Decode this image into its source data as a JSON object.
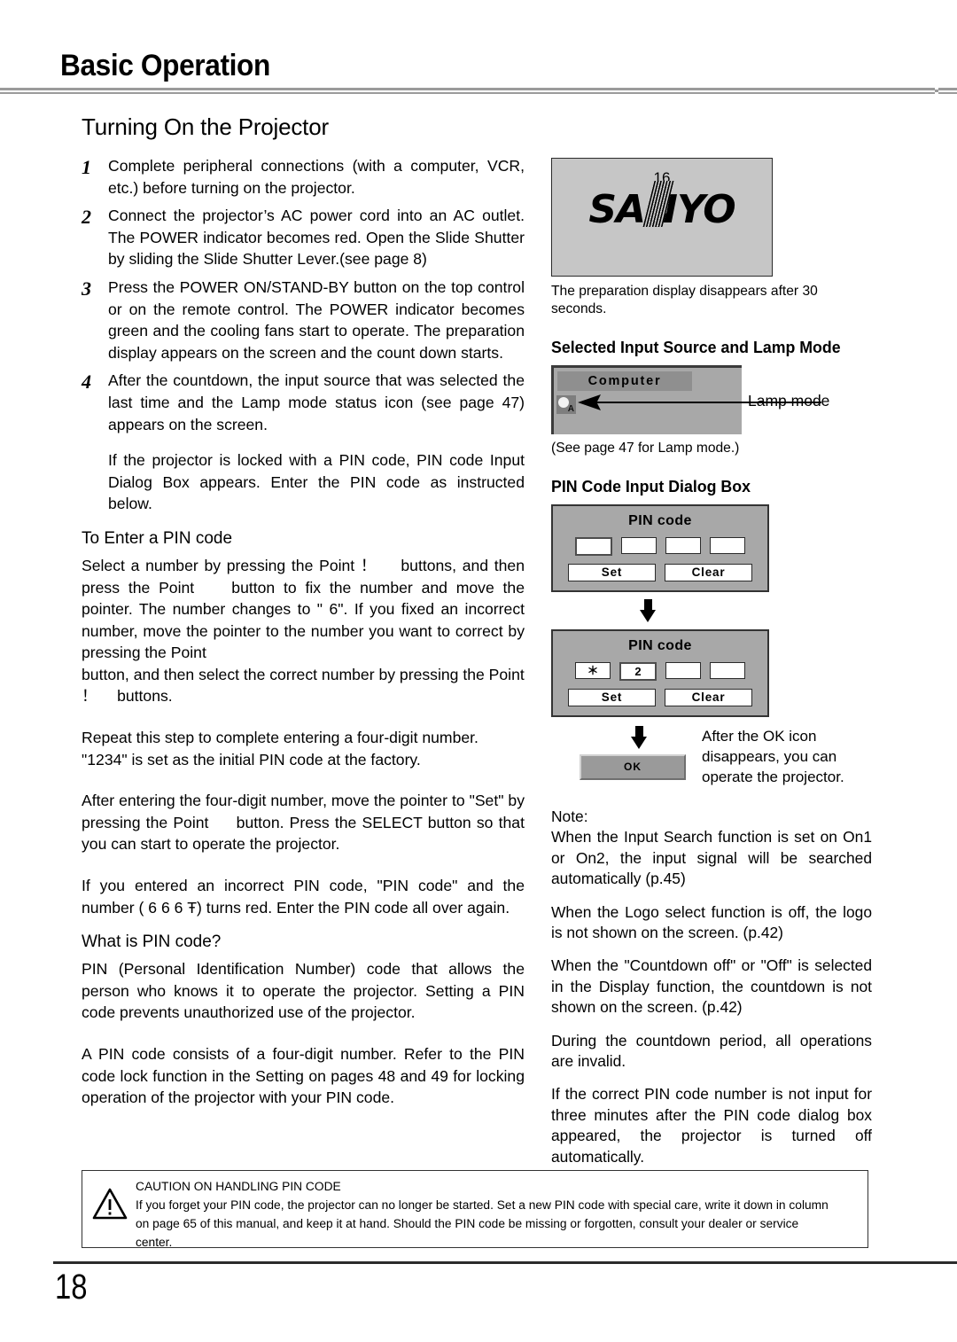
{
  "header": {
    "title": "Basic Operation"
  },
  "left": {
    "section_heading": "Turning On the Projector",
    "steps": [
      {
        "num": "1",
        "text": "Complete peripheral connections (with a computer, VCR, etc.) before turning on the projector."
      },
      {
        "num": "2",
        "text": "Connect the projector’s AC power cord into an AC outlet.  The POWER indicator becomes red. Open the Slide Shutter by sliding the Slide Shutter Lever.(see page 8)"
      },
      {
        "num": "3",
        "text": "Press the POWER ON/STAND-BY button on the top control or on the remote control.  The POWER indicator becomes green and the cooling fans start to operate.  The preparation display appears on the screen and the count down starts."
      },
      {
        "num": "4",
        "text": "After the countdown, the input source that was selected the last time and the Lamp mode status icon (see page 47) appears on the screen."
      }
    ],
    "locked_note": "If the projector is locked with a PIN code, PIN code Input Dialog Box appears.  Enter the PIN code as instructed below.",
    "enter_pin_heading": "To Enter a PIN code",
    "enter_pin_p1": "Select a number by pressing the Point ！　 buttons, and then press the Point 　 button to fix the number and move the pointer.  The number changes to \" 6\".  If you fixed an incorrect number, move the pointer to the number you want to correct by pressing the Point",
    "enter_pin_p2": "button, and then select the correct number by pressing the Point ！　 buttons.",
    "repeat_p": "Repeat this step to complete entering a four-digit number.",
    "factory_p": "\"1234\" is set as the initial PIN code at the factory.",
    "after_entering_p": "After entering the four-digit number, move the pointer to \"Set\" by pressing the Point 　 button.  Press the SELECT button so that you can start to operate the projector.",
    "incorrect_p": "If you entered an incorrect PIN code, \"PIN code\" and the number ( 6 6 6 Ŧ) turns red.  Enter the PIN code all over again.",
    "what_is_pin_heading": "What is PIN code?",
    "what_is_pin_p1": "PIN (Personal Identification Number) code that allows the person who knows it to operate the projector.  Setting a PIN code prevents unauthorized use of the projector.",
    "what_is_pin_p2": "A PIN code consists of a four-digit number. Refer to the PIN code lock function in the Setting on pages 48 and 49 for locking operation of the projector with your PIN code."
  },
  "right": {
    "prep_display": {
      "countdown": "16",
      "logo_s": "SA",
      "logo_slash": "N",
      "logo_yo": "YO"
    },
    "prep_caption": "The preparation display disappears after 30 seconds.",
    "source_heading": "Selected Input Source and Lamp Mode",
    "source_label": "Computer",
    "lamp_mode_callout": "Lamp mode",
    "lamp_icon_letter": "A",
    "source_caption": "(See page 47 for Lamp mode.)",
    "pin_dialog_heading": "PIN Code Input Dialog Box",
    "pin_dialog_1": {
      "title": "PIN code",
      "digits": [
        "",
        "",
        "",
        ""
      ],
      "set_label": "Set",
      "clear_label": "Clear"
    },
    "pin_dialog_2": {
      "title": "PIN code",
      "digits": [
        "＊",
        "2",
        "",
        ""
      ],
      "set_label": "Set",
      "clear_label": "Clear"
    },
    "ok_icon_label": "OK",
    "ok_side_text": "After the OK icon disappears, you can operate the projector.",
    "note_label": "Note:",
    "notes": [
      "When the Input Search function is set on On1 or On2, the input signal will be searched automatically (p.45)",
      "When the Logo select function is off, the logo is not shown on the screen. (p.42)",
      "When the \"Countdown off\" or \"Off\" is selected in the Display function, the countdown is not shown on the screen. (p.42)",
      "During the countdown period, all operations are invalid.",
      "If the correct PIN code number is not input for three minutes after the PIN code dialog box appeared, the projector is turned off automatically."
    ]
  },
  "caution": {
    "title": "CAUTION ON HANDLING PIN CODE",
    "body": "If you forget your PIN code, the projector can no longer be started.  Set a new PIN code with special care, write it down in column on page 65 of this manual, and keep it at hand.  Should the PIN code be missing or forgotten, consult your dealer or service center."
  },
  "footer": {
    "page_number": "18"
  },
  "colors": {
    "screen_gray": "#c6c6c6",
    "dialog_gray": "#a8a8a8",
    "label_gray": "#8f8f8f",
    "rule_gray": "#9b9b9b",
    "ink": "#000000"
  }
}
